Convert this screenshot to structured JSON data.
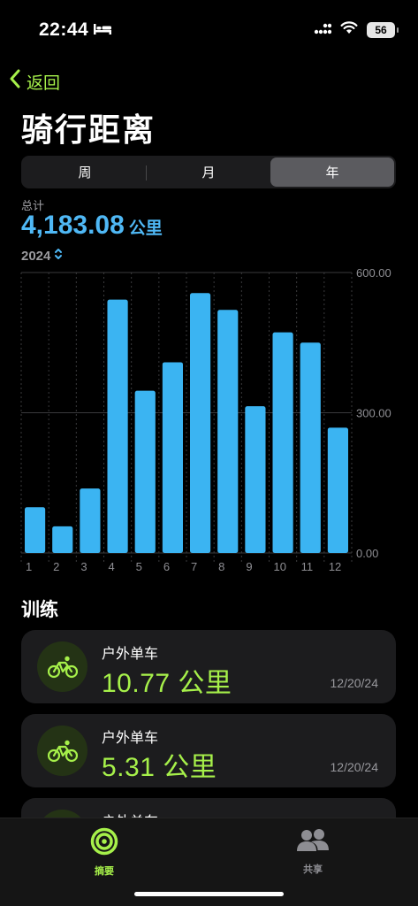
{
  "status_bar": {
    "time": "22:44",
    "battery": "56"
  },
  "nav": {
    "back_label": "返回"
  },
  "page_title": "骑行距离",
  "segments": [
    {
      "label": "周",
      "active": false
    },
    {
      "label": "月",
      "active": false
    },
    {
      "label": "年",
      "active": true
    }
  ],
  "summary": {
    "total_label": "总计",
    "total_value": "4,183.08",
    "total_unit": "公里",
    "year": "2024"
  },
  "chart_data": {
    "type": "bar",
    "categories": [
      "1",
      "2",
      "3",
      "4",
      "5",
      "6",
      "7",
      "8",
      "9",
      "10",
      "11",
      "12"
    ],
    "values": [
      98,
      57,
      138,
      542,
      347,
      408,
      556,
      520,
      314,
      472,
      450,
      268
    ],
    "ylim": [
      0,
      600
    ],
    "yticks": [
      "600.00",
      "300.00",
      "0.00"
    ],
    "ytick_values": [
      600,
      300,
      0
    ],
    "grid": true,
    "bar_color": "#3bb4f2"
  },
  "workouts_title": "训练",
  "workouts": [
    {
      "type": "户外单车",
      "distance": "10.77 公里",
      "date": "12/20/24"
    },
    {
      "type": "户外单车",
      "distance": "5.31 公里",
      "date": "12/20/24"
    },
    {
      "type": "户外单车",
      "distance": "",
      "date": ""
    }
  ],
  "tab_bar": {
    "summary_label": "摘要",
    "sharing_label": "共享",
    "active_color": "#a6f04a",
    "inactive_color": "#8e8e93"
  }
}
